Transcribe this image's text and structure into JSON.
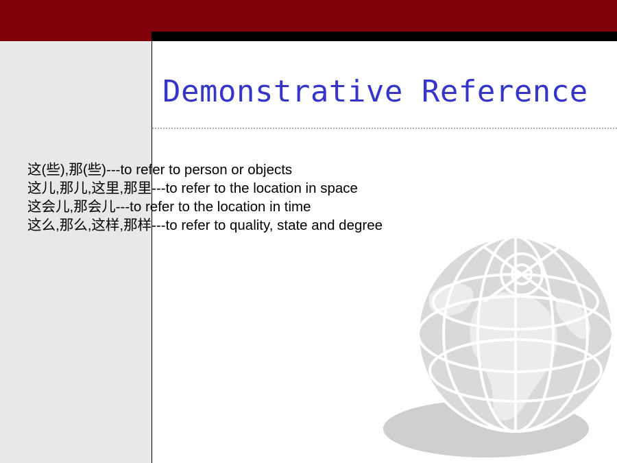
{
  "slide": {
    "title": "Demonstrative Reference",
    "lines": [
      "这(些),那(些)---to refer to person or objects",
      "这儿,那儿,这里,那里---to refer to the location in space",
      "这会儿,那会儿---to refer to the location in time",
      "这么,那么,这样,那样---to refer to quality, state and degree"
    ],
    "decoration_icon": "globe-icon"
  },
  "colors": {
    "header_band": "#7f0008",
    "title": "#3535c8",
    "left_panel": "#e8e8e8",
    "globe": "#d6d6d6"
  }
}
